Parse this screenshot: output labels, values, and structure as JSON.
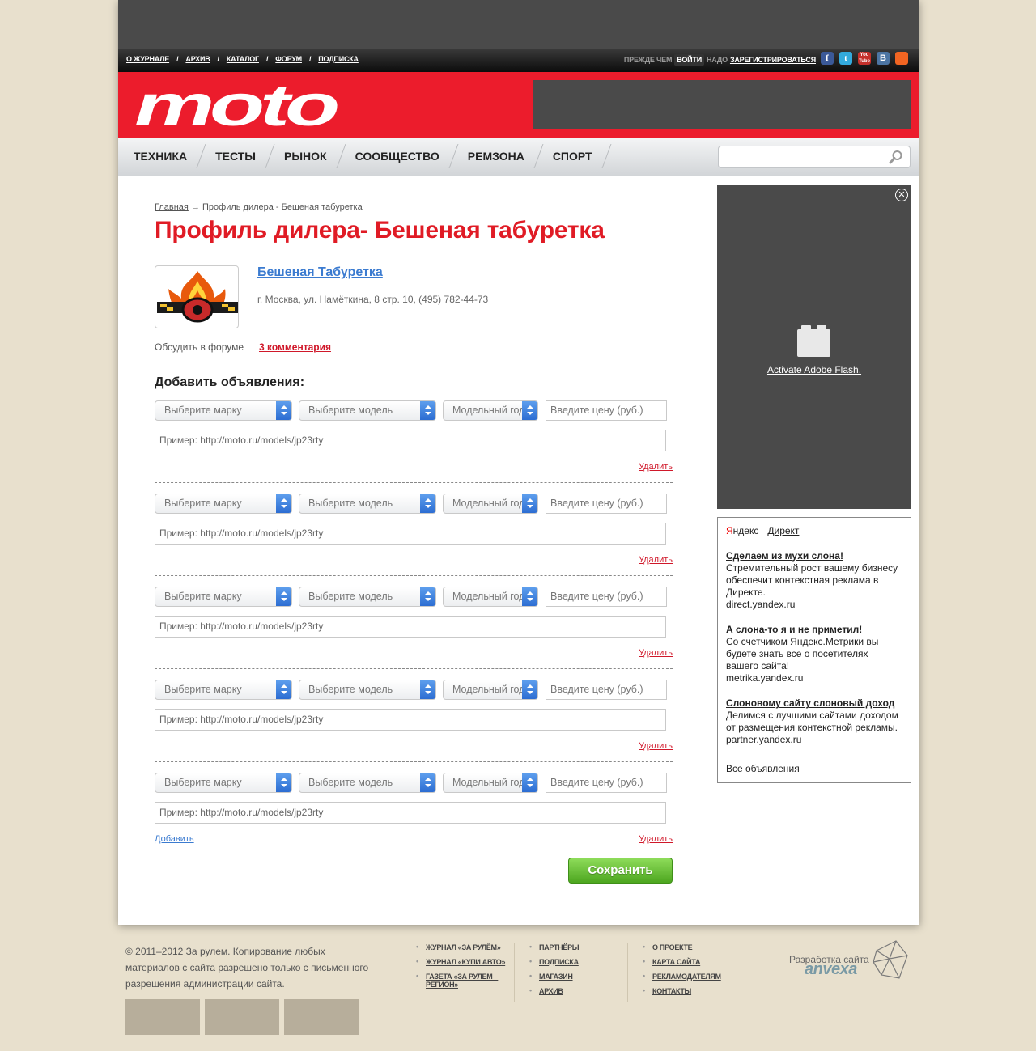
{
  "topnav": {
    "items": [
      "О ЖУРНАЛЕ",
      "АРХИВ",
      "КАТАЛОГ",
      "ФОРУМ",
      "ПОДПИСКА"
    ],
    "separator": "/"
  },
  "auth": {
    "before": "ПРЕЖДЕ ЧЕМ",
    "login": "ВОЙТИ",
    "need": "НАДО",
    "register": "ЗАРЕГИСТРИРОВАТЬСЯ"
  },
  "social": {
    "facebook": "f",
    "twitter": "t",
    "youtube": "You Tube",
    "vk": "B",
    "rss": "rss"
  },
  "logo": "moto",
  "menu": [
    "ТЕХНИКА",
    "ТЕСТЫ",
    "РЫНОК",
    "СООБЩЕСТВО",
    "РЕМЗОНА",
    "СПОРТ"
  ],
  "breadcrumb": {
    "home": "Главная",
    "arrow": "→",
    "current": "Профиль дилера - Бешеная табуретка"
  },
  "page_title": "Профиль дилера- Бешеная табуретка",
  "dealer": {
    "name": "Бешеная Табуретка",
    "address": "г. Москва, ул. Намёткина, 8 стр. 10, (495) 782-44-73"
  },
  "discuss": {
    "label": "Обсудить в форуме",
    "comments": "3 комментария"
  },
  "add_title": "Добавить объявления:",
  "listing_fields": {
    "brand": "Выберите марку",
    "model": "Выберите модель",
    "year": "Модельный год",
    "price": "Введите цену (руб.)",
    "url": "Пример: http://moto.ru/models/jp23rty"
  },
  "listings_count": 5,
  "delete_label": "Удалить",
  "add_label": "Добавить",
  "save_label": "Сохранить",
  "side_ad": {
    "close": "✕",
    "flash": "Activate Adobe Flash."
  },
  "yandex": {
    "brand": "Яндекс",
    "direct": "Директ",
    "ads": [
      {
        "title": "Сделаем из мухи слона!",
        "text": "Стремительный рост вашему бизнесу обеспечит контекстная реклама в Директе.",
        "domain": "direct.yandex.ru"
      },
      {
        "title": "А слона-то я и не приметил!",
        "text": "Со счетчиком Яндекс.Метрики вы будете знать все о посетителях вашего сайта!",
        "domain": "metrika.yandex.ru"
      },
      {
        "title": "Слоновому сайту слоновый доход",
        "text": "Делимся с лучшими сайтами доходом от размещения контекстной рекламы.",
        "domain": "partner.yandex.ru"
      }
    ],
    "all": "Все объявления"
  },
  "footer": {
    "copyright": "© 2011–2012 За рулем. Копирование любых материалов с сайта разрешено только с письменного разрешения администрации сайта.",
    "col1": [
      "ЖУРНАЛ «ЗА РУЛЁМ»",
      "ЖУРНАЛ «КУПИ АВТО»",
      "ГАЗЕТА «ЗА РУЛЁМ – РЕГИОН»"
    ],
    "col2": [
      "ПАРТНЁРЫ",
      "ПОДПИСКА",
      "МАГАЗИН",
      "АРХИВ"
    ],
    "col3": [
      "О ПРОЕКТЕ",
      "КАРТА САЙТА",
      "РЕКЛАМОДАТЕЛЯМ",
      "КОНТАКТЫ"
    ],
    "dev_label": "Разработка сайта",
    "dev_name": "anvexa"
  },
  "colors": {
    "brand_red": "#ec1c2c",
    "link_blue": "#3b7bd0",
    "save_green": "#4da61f",
    "bg": "#e8e0cd"
  }
}
